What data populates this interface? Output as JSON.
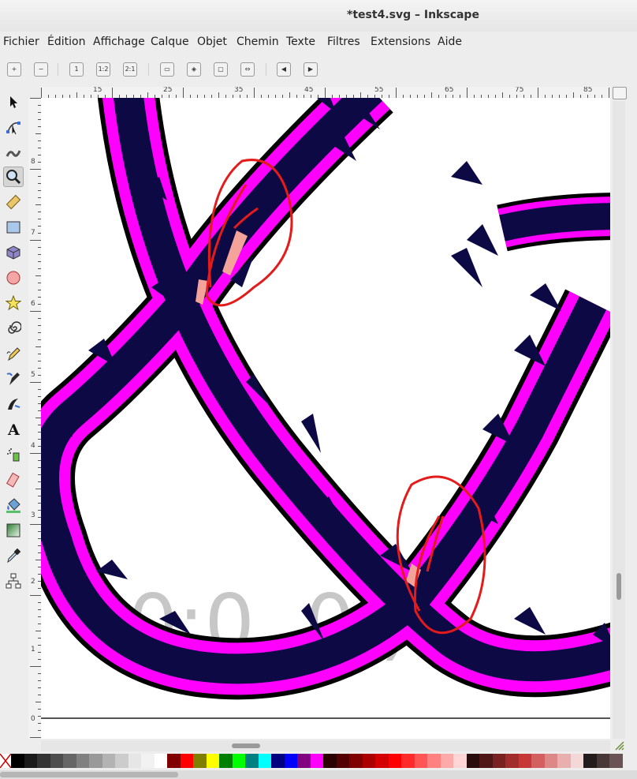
{
  "window": {
    "title": "*test4.svg – Inkscape"
  },
  "menu": [
    "Fichier",
    "Édition",
    "Affichage",
    "Calque",
    "Objet",
    "Chemin",
    "Texte",
    "Filtres",
    "Extensions",
    "Aide"
  ],
  "commands": [
    {
      "name": "zoom-in-icon",
      "glyph": "+"
    },
    {
      "name": "zoom-out-icon",
      "glyph": "−"
    },
    {
      "name": "zoom-1-1-icon",
      "glyph": "1"
    },
    {
      "name": "zoom-1-2-icon",
      "glyph": "1:2"
    },
    {
      "name": "zoom-2-1-icon",
      "glyph": "2:1"
    },
    {
      "name": "zoom-selection-icon",
      "glyph": "▭"
    },
    {
      "name": "zoom-drawing-icon",
      "glyph": "◈"
    },
    {
      "name": "zoom-page-icon",
      "glyph": "▢"
    },
    {
      "name": "zoom-page-width-icon",
      "glyph": "⇔"
    },
    {
      "name": "zoom-previous-icon",
      "glyph": "◀"
    },
    {
      "name": "zoom-next-icon",
      "glyph": "▶"
    }
  ],
  "tools": [
    {
      "name": "selector-tool",
      "icon": "arrow-pointer-icon"
    },
    {
      "name": "node-tool",
      "icon": "node-edit-icon"
    },
    {
      "name": "tweak-tool",
      "icon": "tweak-icon"
    },
    {
      "name": "zoom-tool",
      "icon": "magnifier-icon",
      "active": true
    },
    {
      "name": "measure-tool",
      "icon": "ruler-icon"
    },
    {
      "name": "rectangle-tool",
      "icon": "rectangle-icon"
    },
    {
      "name": "3d-box-tool",
      "icon": "cube-icon"
    },
    {
      "name": "ellipse-tool",
      "icon": "circle-icon"
    },
    {
      "name": "star-tool",
      "icon": "star-icon"
    },
    {
      "name": "spiral-tool",
      "icon": "spiral-icon"
    },
    {
      "name": "pencil-tool",
      "icon": "pencil-icon"
    },
    {
      "name": "pen-tool",
      "icon": "pen-icon"
    },
    {
      "name": "calligraphy-tool",
      "icon": "calligraphy-icon"
    },
    {
      "name": "text-tool",
      "icon": "text-A-icon"
    },
    {
      "name": "spray-tool",
      "icon": "spray-icon"
    },
    {
      "name": "eraser-tool",
      "icon": "eraser-icon"
    },
    {
      "name": "paint-bucket-tool",
      "icon": "bucket-icon"
    },
    {
      "name": "gradient-tool",
      "icon": "gradient-icon"
    },
    {
      "name": "dropper-tool",
      "icon": "dropper-icon"
    },
    {
      "name": "connector-tool",
      "icon": "connector-icon"
    }
  ],
  "ruler": {
    "horizontal_labels": [
      "15",
      "25",
      "35",
      "45",
      "55",
      "65",
      "75",
      "85"
    ],
    "vertical_labels": [
      "8",
      "7",
      "6",
      "5",
      "4",
      "3",
      "2",
      "1",
      "0"
    ]
  },
  "canvas": {
    "background_text": "0:0  ,0 )",
    "colors": {
      "ribbon": "#ff00ff",
      "spikes": "#0d0945",
      "outline": "#000000",
      "highlight": "#f4a39a",
      "annotation": "#e31b1b"
    }
  },
  "palette": [
    "#000000",
    "#1a1a1a",
    "#333333",
    "#4d4d4d",
    "#666666",
    "#808080",
    "#999999",
    "#b3b3b3",
    "#cccccc",
    "#e6e6e6",
    "#f2f2f2",
    "#ffffff",
    "#800000",
    "#ff0000",
    "#808000",
    "#ffff00",
    "#008000",
    "#00ff00",
    "#008080",
    "#00ffff",
    "#000080",
    "#0000ff",
    "#800080",
    "#ff00ff",
    "#2b0000",
    "#550000",
    "#800000",
    "#aa0000",
    "#d40000",
    "#ff0000",
    "#ff2a2a",
    "#ff5555",
    "#ff8080",
    "#ffaaaa",
    "#ffd5d5",
    "#280b0b",
    "#501616",
    "#782121",
    "#a02c2c",
    "#c83737",
    "#d35f5f",
    "#de8787",
    "#e9afaf",
    "#f4d7d7",
    "#241c1c",
    "#483737",
    "#6c5353"
  ]
}
